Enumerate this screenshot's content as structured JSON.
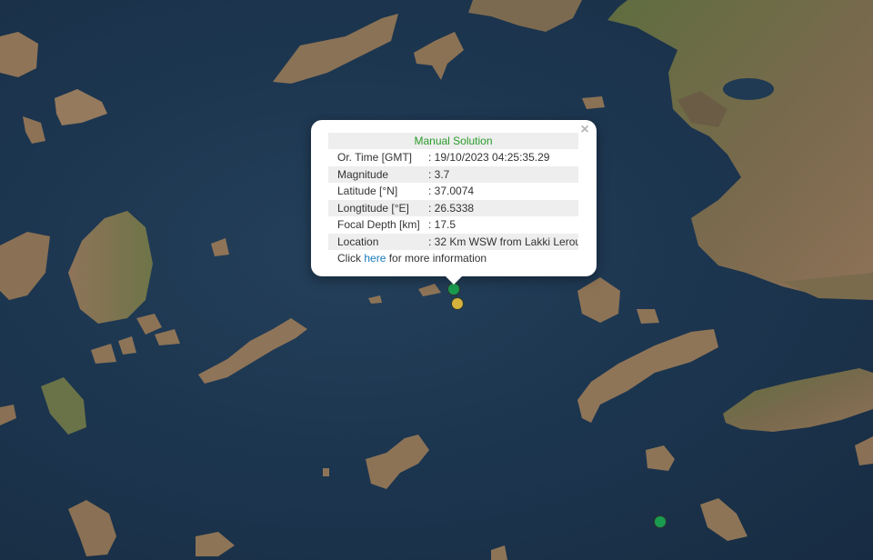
{
  "map": {
    "colors": {
      "sea": "#1d3650",
      "land": "#8a7158",
      "land_green": "#5d6e3c"
    }
  },
  "markers": [
    {
      "name": "quake-marker-selected",
      "color": "#1a9c50"
    },
    {
      "name": "quake-marker-yellow",
      "color": "#d4b23c"
    },
    {
      "name": "quake-marker-south",
      "color": "#1a9c50"
    }
  ],
  "popup": {
    "title": "Manual Solution",
    "title_color": "#2a9b2a",
    "close_symbol": "×",
    "rows": [
      {
        "label": "Or. Time [GMT]",
        "value": ": 19/10/2023 04:25:35.29"
      },
      {
        "label": "Magnitude",
        "value": ": 3.7"
      },
      {
        "label": "Latitude [°N]",
        "value": ": 37.0074"
      },
      {
        "label": "Longtitude [°E]",
        "value": ": 26.5338"
      },
      {
        "label": "Focal Depth [km]",
        "value": ": 17.5"
      },
      {
        "label": "Location",
        "value": ": 32 Km WSW from Lakki Lerou"
      }
    ],
    "more": {
      "prefix": "Click ",
      "link": "here",
      "suffix": " for more information"
    }
  }
}
